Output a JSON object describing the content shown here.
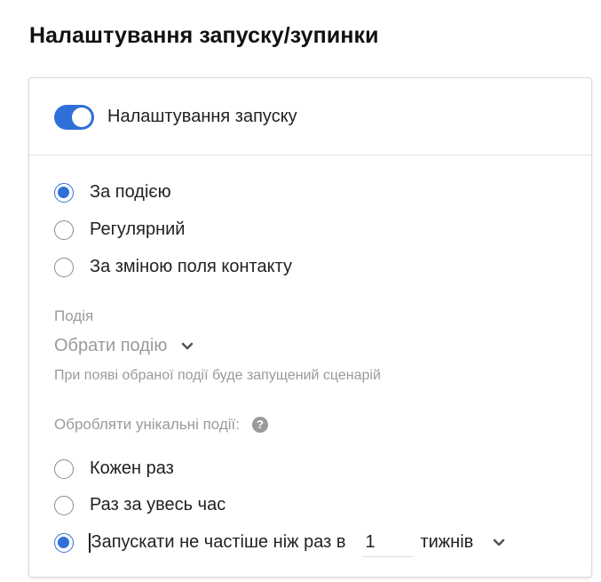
{
  "page": {
    "title": "Налаштування запуску/зупинки"
  },
  "launch": {
    "toggle_on": true,
    "toggle_label": "Налаштування запуску",
    "toggle_color": "#2f6fd8"
  },
  "trigger_type": {
    "selected": "event",
    "options": [
      {
        "id": "event",
        "label": "За подією",
        "checked": true
      },
      {
        "id": "regular",
        "label": "Регулярний",
        "checked": false
      },
      {
        "id": "contact-field",
        "label": "За зміною поля контакту",
        "checked": false
      }
    ]
  },
  "event": {
    "label": "Подія",
    "placeholder": "Обрати подію",
    "hint": "При появі обраної події буде запущений сценарій"
  },
  "unique_events": {
    "label": "Обробляти унікальні події:",
    "help_icon": "question-circle-icon",
    "options": [
      {
        "id": "every-time",
        "label": "Кожен раз",
        "checked": false
      },
      {
        "id": "once",
        "label": "Раз за увесь час",
        "checked": false
      },
      {
        "id": "limit",
        "label": "Запускати не частіше ніж раз в",
        "checked": true
      }
    ],
    "frequency_value": "1",
    "frequency_unit": "тижнів"
  }
}
